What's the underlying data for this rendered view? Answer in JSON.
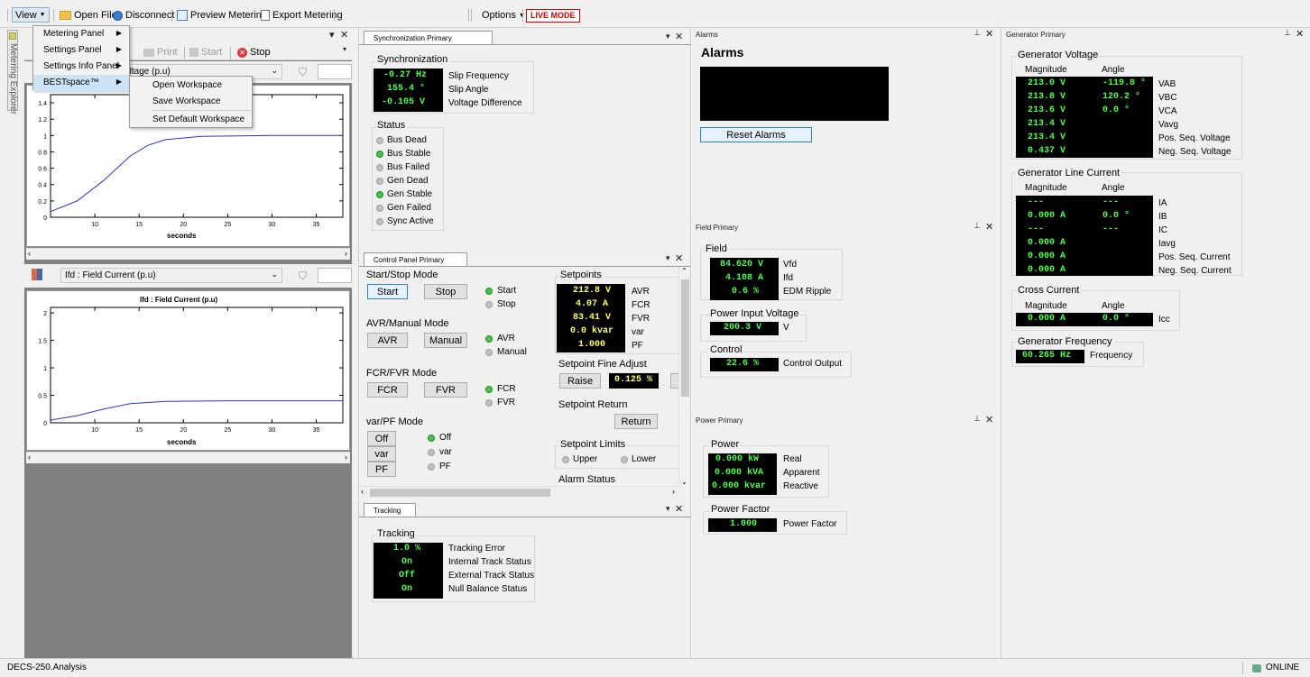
{
  "toolbar": {
    "view_label": "View",
    "open_file": "Open File",
    "disconnect": "Disconnect",
    "preview_metering": "Preview Metering",
    "export_metering": "Export Metering",
    "options": "Options",
    "live_mode": "LIVE MODE",
    "print": "Print",
    "start": "Start",
    "stop": "Stop"
  },
  "view_menu": {
    "items": [
      "Metering Panel",
      "Settings Panel",
      "Settings Info Panel",
      "BESTspace™"
    ],
    "submenu": [
      "Open Workspace",
      "Save Workspace",
      "Set Default Workspace"
    ]
  },
  "metering_explorer": "Metering Explorer",
  "left": {
    "plot1_combo": "Voltage (p.u)",
    "plot1_xlabel": "seconds",
    "plot1_yticks": [
      "1.4",
      "1.2",
      "1",
      "0.8",
      "0.6",
      "0.4",
      "0.2",
      "0"
    ],
    "plot1_xticks": [
      "10",
      "15",
      "20",
      "25",
      "30",
      "35"
    ],
    "plot2_combo": "Ifd : Field Current (p.u)",
    "plot2_title": "Ifd : Field Current (p.u)",
    "plot2_xlabel": "seconds",
    "plot2_yticks": [
      "2",
      "1.5",
      "1",
      "0.5",
      "0"
    ],
    "plot2_xticks": [
      "10",
      "15",
      "20",
      "25",
      "30",
      "35"
    ]
  },
  "chart_data": [
    {
      "type": "line",
      "title": "",
      "xlabel": "seconds",
      "ylabel": "",
      "xlim": [
        5,
        38
      ],
      "ylim": [
        0,
        1.5
      ],
      "series": [
        {
          "values": [
            [
              5,
              0.07
            ],
            [
              8,
              0.2
            ],
            [
              11,
              0.45
            ],
            [
              14,
              0.75
            ],
            [
              16,
              0.88
            ],
            [
              18,
              0.95
            ],
            [
              22,
              0.99
            ],
            [
              30,
              1.0
            ],
            [
              38,
              1.0
            ]
          ]
        }
      ]
    },
    {
      "type": "line",
      "title": "Ifd : Field Current (p.u)",
      "xlabel": "seconds",
      "ylabel": "",
      "xlim": [
        5,
        38
      ],
      "ylim": [
        0,
        2.1
      ],
      "series": [
        {
          "values": [
            [
              5,
              0.05
            ],
            [
              8,
              0.13
            ],
            [
              11,
              0.25
            ],
            [
              14,
              0.35
            ],
            [
              18,
              0.39
            ],
            [
              25,
              0.4
            ],
            [
              38,
              0.4
            ]
          ]
        }
      ]
    }
  ],
  "sync": {
    "tab": "Synchronization Primary",
    "group": "Synchronization",
    "values": [
      "-0.27 Hz",
      "155.4 °",
      "-0.105 V"
    ],
    "labels": [
      "Slip Frequency",
      "Slip Angle",
      "Voltage Difference"
    ],
    "status_title": "Status",
    "status": [
      {
        "label": "Bus Dead",
        "on": false
      },
      {
        "label": "Bus Stable",
        "on": true
      },
      {
        "label": "Bus Failed",
        "on": false
      },
      {
        "label": "Gen Dead",
        "on": false
      },
      {
        "label": "Gen Stable",
        "on": true
      },
      {
        "label": "Gen Failed",
        "on": false
      },
      {
        "label": "Sync Active",
        "on": false
      }
    ]
  },
  "control": {
    "tab": "Control Panel Primary",
    "start_stop_title": "Start/Stop Mode",
    "start_btn": "Start",
    "stop_btn": "Stop",
    "start_led": "Start",
    "stop_led": "Stop",
    "avr_title": "AVR/Manual Mode",
    "avr_btn": "AVR",
    "manual_btn": "Manual",
    "avr_led": "AVR",
    "manual_led": "Manual",
    "fcr_title": "FCR/FVR Mode",
    "fcr_btn": "FCR",
    "fvr_btn": "FVR",
    "fcr_led": "FCR",
    "fvr_led": "FVR",
    "var_title": "var/PF Mode",
    "off_btn": "Off",
    "var_btn": "var",
    "pf_btn": "PF",
    "off_led": "Off",
    "var_led": "var",
    "pf_led": "PF",
    "setpoints_title": "Setpoints",
    "setpoints": [
      {
        "value": "212.8 V",
        "label": "AVR"
      },
      {
        "value": "4.07 A",
        "label": "FCR"
      },
      {
        "value": "83.41 V",
        "label": "FVR"
      },
      {
        "value": "0.0 kvar",
        "label": "var"
      },
      {
        "value": "1.000",
        "label": "PF"
      }
    ],
    "fine_title": "Setpoint Fine Adjust",
    "raise_btn": "Raise",
    "fine_value": "0.125 %",
    "return_title": "Setpoint Return",
    "return_btn": "Return",
    "limits_title": "Setpoint Limits",
    "upper": "Upper",
    "lower": "Lower",
    "alarm_status": "Alarm Status"
  },
  "tracking": {
    "tab": "Tracking",
    "group": "Tracking",
    "values": [
      "1.0 %",
      "On",
      "Off",
      "On"
    ],
    "labels": [
      "Tracking Error",
      "Internal Track Status",
      "External Track Status",
      "Null Balance Status"
    ]
  },
  "alarms": {
    "header": "Alarms",
    "title": "Alarms",
    "reset_btn": "Reset Alarms"
  },
  "field": {
    "header": "Field Primary",
    "group": "Field",
    "values": [
      "84.620 V",
      "4.108 A",
      "0.6 %"
    ],
    "labels": [
      "Vfd",
      "Ifd",
      "EDM Ripple"
    ],
    "piv_title": "Power Input Voltage",
    "piv_value": "200.3 V",
    "piv_unit": "V",
    "control_title": "Control",
    "control_value": "22.6 %",
    "control_label": "Control Output"
  },
  "power": {
    "header": "Power Primary",
    "group": "Power",
    "values": [
      "0.000 kW",
      "0.000 kVA",
      "0.000 kvar"
    ],
    "labels": [
      "Real",
      "Apparent",
      "Reactive"
    ],
    "pf_title": "Power Factor",
    "pf_value": "1.000",
    "pf_label": "Power Factor"
  },
  "generator": {
    "header": "Generator Primary",
    "voltage_title": "Generator Voltage",
    "mag_hdr": "Magnitude",
    "ang_hdr": "Angle",
    "voltage_rows": [
      {
        "mag": "213.0 V",
        "ang": "-119.8 °",
        "label": "VAB"
      },
      {
        "mag": "213.8 V",
        "ang": "120.2 °",
        "label": "VBC"
      },
      {
        "mag": "213.6 V",
        "ang": "0.0 °",
        "label": "VCA"
      },
      {
        "mag": "213.4 V",
        "ang": "",
        "label": "Vavg"
      },
      {
        "mag": "213.4 V",
        "ang": "",
        "label": "Pos. Seq. Voltage"
      },
      {
        "mag": "0.437 V",
        "ang": "",
        "label": "Neg. Seq. Voltage"
      }
    ],
    "current_title": "Generator Line Current",
    "current_rows": [
      {
        "mag": "---",
        "ang": "---",
        "label": "IA"
      },
      {
        "mag": "0.000 A",
        "ang": "0.0 °",
        "label": "IB"
      },
      {
        "mag": "---",
        "ang": "---",
        "label": "IC"
      },
      {
        "mag": "0.000 A",
        "ang": "",
        "label": "Iavg"
      },
      {
        "mag": "0.000 A",
        "ang": "",
        "label": "Pos. Seq. Current"
      },
      {
        "mag": "0.000 A",
        "ang": "",
        "label": "Neg. Seq. Current"
      }
    ],
    "cross_title": "Cross Current",
    "cross_mag": "0.000 A",
    "cross_ang": "0.0 °",
    "cross_label": "Icc",
    "freq_title": "Generator Frequency",
    "freq_value": "60.265 Hz",
    "freq_label": "Frequency"
  },
  "status": {
    "app": "DECS-250.Analysis",
    "online": "ONLINE"
  }
}
